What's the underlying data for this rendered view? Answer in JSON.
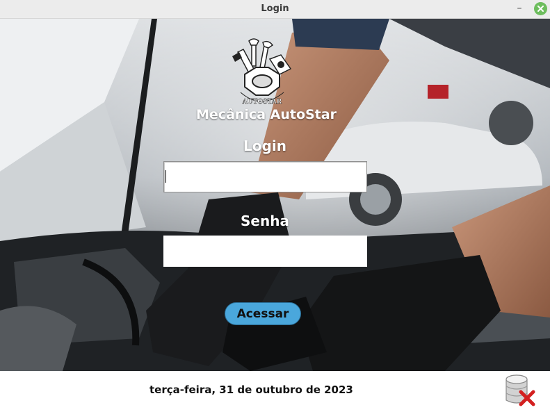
{
  "window": {
    "title": "Login",
    "minimize_glyph": "–"
  },
  "brand": {
    "logo_text": "AUTOSTAR",
    "name": "Mecânica AutoStar"
  },
  "form": {
    "login_label": "Login",
    "login_value": "",
    "senha_label": "Senha",
    "senha_value": "",
    "submit_label": "Acessar"
  },
  "footer": {
    "date": "terça-feira, 31 de outubro de 2023",
    "db_icon": "database-disconnect-icon"
  },
  "colors": {
    "button_bg": "#4aa7dc",
    "close_button": "#6dbd5d",
    "db_icon_x": "#d32020"
  }
}
